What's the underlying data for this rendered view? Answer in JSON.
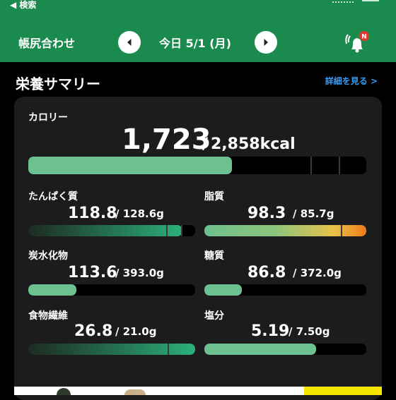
{
  "status_bar": {
    "back_label": "◀ 検索"
  },
  "header": {
    "title": "帳尻合わせ",
    "date": "今日 5/1 (月)",
    "prev_icon": "chevron-left-icon",
    "next_icon": "chevron-right-icon",
    "notification_badge": "N"
  },
  "summary": {
    "title": "栄養サマリー",
    "detail_link": "詳細を見る >",
    "calorie": {
      "label": "カロリー",
      "value": "1,723",
      "separator": "/",
      "goal": "2,858kcal",
      "progress": 0.603
    },
    "nutrients": [
      {
        "label": "たんぱく質",
        "value": "118.8",
        "goal": "/ 128.6g",
        "progress": 0.924,
        "color": "gradient-green"
      },
      {
        "label": "脂質",
        "value": "98.3",
        "goal": "/ 85.7g",
        "progress": 1.0,
        "color": "gradient-orange"
      },
      {
        "label": "炭水化物",
        "value": "113.6",
        "goal": "/ 393.0g",
        "progress": 0.289,
        "color": "#6dc08f"
      },
      {
        "label": "糖質",
        "value": "86.8",
        "goal": "/ 372.0g",
        "progress": 0.233,
        "color": "#6dc08f"
      },
      {
        "label": "食物繊維",
        "value": "26.8",
        "goal": "/ 21.0g",
        "progress": 1.0,
        "color": "gradient-teal"
      },
      {
        "label": "塩分",
        "value": "5.19",
        "goal": "/ 7.50g",
        "progress": 0.692,
        "color": "#6dc08f"
      }
    ]
  },
  "colors": {
    "header_green": "#1a8a4e",
    "bar_green": "#6dc08f",
    "link_blue": "#3a9cf0",
    "badge_red": "#e03a2f",
    "card_bg": "#1c1c1e"
  }
}
